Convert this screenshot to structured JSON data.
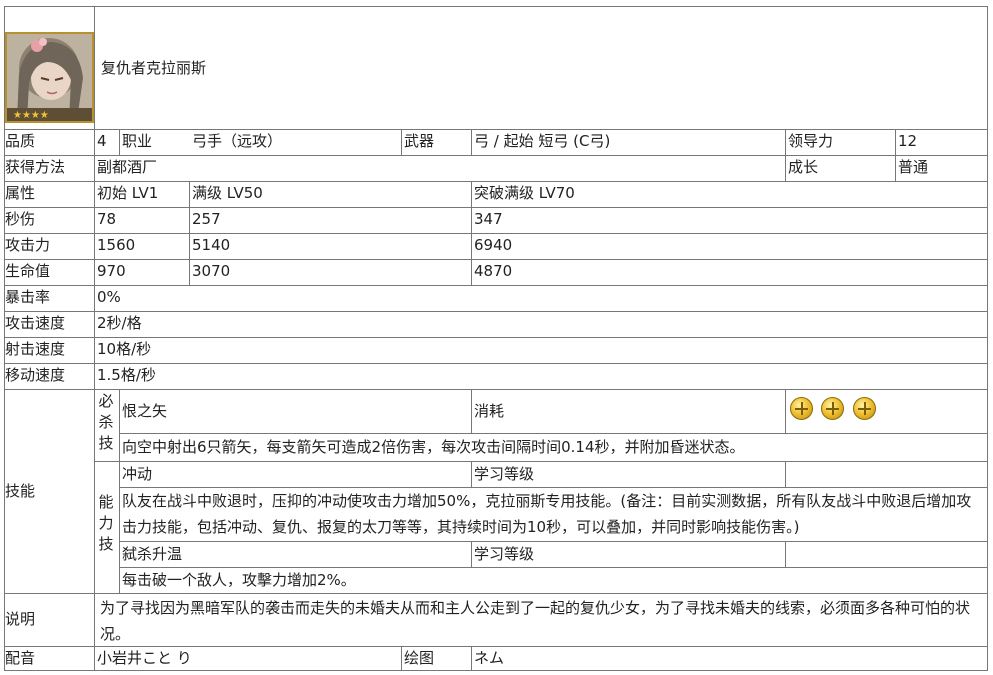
{
  "character": {
    "name": "复仇者克拉丽斯"
  },
  "rows": {
    "quality": {
      "label": "品质",
      "value": "4"
    },
    "job": {
      "label": "职业",
      "value": "弓手（远攻）"
    },
    "weapon": {
      "label": "武器",
      "value": "弓 / 起始 短弓 (C弓)"
    },
    "leadership": {
      "label": "领导力",
      "value": "12"
    },
    "obtain": {
      "label": "获得方法",
      "value": "副都酒厂"
    },
    "growth": {
      "label": "成长",
      "value": "普通"
    },
    "attribute": {
      "label": "属性",
      "init": "初始 LV1",
      "max": "满级 LV50",
      "break": "突破满级 LV70"
    },
    "dps": {
      "label": "秒伤",
      "init": "78",
      "max": "257",
      "break": "347"
    },
    "attack": {
      "label": "攻击力",
      "init": "1560",
      "max": "5140",
      "break": "6940"
    },
    "hp": {
      "label": "生命值",
      "init": "970",
      "max": "3070",
      "break": "4870"
    },
    "crit": {
      "label": "暴击率",
      "value": "0%"
    },
    "atk_speed": {
      "label": "攻击速度",
      "value": "2秒/格"
    },
    "shot_speed": {
      "label": "射击速度",
      "value": "10格/秒"
    },
    "move_speed": {
      "label": "移动速度",
      "value": "1.5格/秒"
    }
  },
  "skills": {
    "label": "技能",
    "special": {
      "type_label": "必杀技",
      "name": "恨之矢",
      "cost_label": "消耗",
      "cost_icons": [
        "coin-icon",
        "coin-icon",
        "coin-icon"
      ],
      "desc": "向空中射出6只箭矢，每支箭矢可造成2倍伤害，每次攻击间隔时间0.14秒，并附加昏迷状态。"
    },
    "abilities": {
      "type_label": "能力技",
      "items": [
        {
          "name": "冲动",
          "level_label": "学习等级",
          "level": "",
          "desc": "队友在战斗中败退时，压抑的冲动使攻击力增加50%，克拉丽斯专用技能。(备注：目前实测数据，所有队友战斗中败退后增加攻击力技能，包括冲动、复仇、报复的太刀等等，其持续时间为10秒，可以叠加，并同时影响技能伤害。)"
        },
        {
          "name": "弑杀升温",
          "level_label": "学习等级",
          "level": "",
          "desc": "每击破一个敌人，攻擊力增加2%。"
        }
      ]
    }
  },
  "description": {
    "label": "说明",
    "text": "为了寻找因为黑暗军队的袭击而走失的未婚夫从而和主人公走到了一起的复仇少女，为了寻找未婚夫的线索，必须面多各种可怕的状况。"
  },
  "voice": {
    "label": "配音",
    "value": "小岩井こと り"
  },
  "illust": {
    "label": "绘图",
    "value": "ネム"
  },
  "colors": {
    "border": "#777777",
    "frame": "#b8912f",
    "coin": "#f1c233"
  }
}
